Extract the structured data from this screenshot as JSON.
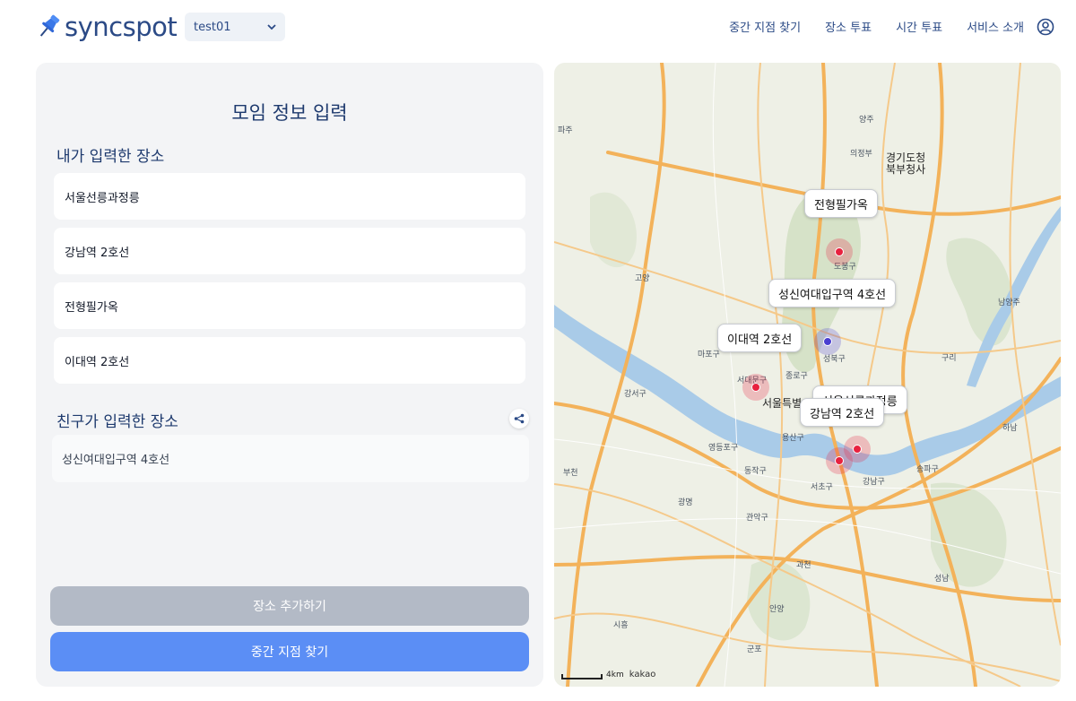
{
  "header": {
    "logo_text": "syncspot",
    "room_select_value": "test01",
    "nav": [
      "중간 지점 찾기",
      "장소 투표",
      "시간 투표",
      "서비스 소개"
    ]
  },
  "panel": {
    "title": "모임 정보 입력",
    "my_places_title": "내가 입력한 장소",
    "my_places": [
      "서울선릉과정릉",
      "강남역 2호선",
      "전형필가옥",
      "이대역 2호선"
    ],
    "friend_places_title": "친구가 입력한 장소",
    "friend_places": [
      "성신여대입구역 4호선"
    ],
    "add_button": "장소 추가하기",
    "find_button": "중간 지점 찾기"
  },
  "map": {
    "labels": {
      "jeonhyeong": "전형필가옥",
      "sungshin": "성신여대입구역 4호선",
      "idae": "이대역 2호선",
      "seolleung": "서울선릉과정릉",
      "gangnam": "강남역 2호선"
    },
    "city_label": "서울특별시",
    "places": [
      "양주",
      "파주",
      "의정부",
      "경기도청 북부청사",
      "고양",
      "구리",
      "남양주",
      "하남",
      "부천",
      "광명",
      "과천",
      "성남",
      "안양",
      "시흥",
      "군포",
      "도봉구",
      "성북구",
      "서대문구",
      "종로구",
      "강서구",
      "영등포구",
      "동작구",
      "서초구",
      "강남구",
      "송파구",
      "관악구",
      "마포구",
      "용산구"
    ],
    "scale_text": "4km",
    "attribution": "kakao",
    "marker_colors": {
      "mine": "#e8213f",
      "friend": "#4a3fd1"
    }
  }
}
